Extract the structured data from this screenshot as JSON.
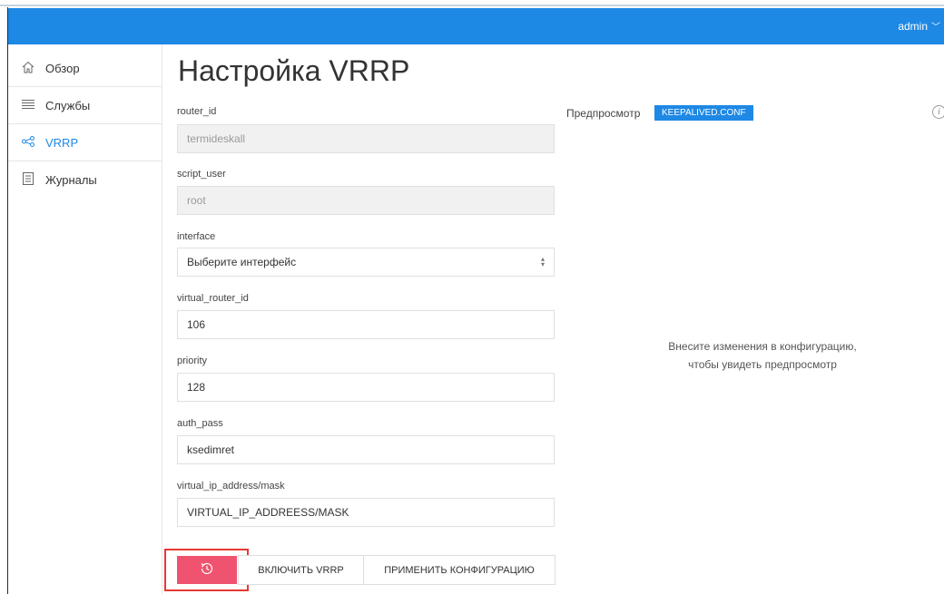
{
  "header": {
    "user": "admin",
    "user_chevron": "﹀"
  },
  "sidebar": {
    "items": [
      {
        "label": "Обзор",
        "icon": "home-icon"
      },
      {
        "label": "Службы",
        "icon": "list-icon"
      },
      {
        "label": "VRRP",
        "icon": "share-icon",
        "active": true
      },
      {
        "label": "Журналы",
        "icon": "document-icon"
      }
    ]
  },
  "main": {
    "title": "Настройка VRRP",
    "fields": {
      "router_id": {
        "label": "router_id",
        "value": "termideskall"
      },
      "script_user": {
        "label": "script_user",
        "value": "root"
      },
      "interface": {
        "label": "interface",
        "value": "Выберите интерфейс"
      },
      "virtual_router_id": {
        "label": "virtual_router_id",
        "value": "106"
      },
      "priority": {
        "label": "priority",
        "value": "128"
      },
      "auth_pass": {
        "label": "auth_pass",
        "value": "ksedimret"
      },
      "virtual_ip": {
        "label": "virtual_ip_address/mask",
        "value": "VIRTUAL_IP_ADDREESS/MASK"
      }
    },
    "buttons": {
      "enable": "ВКЛЮЧИТЬ VRRP",
      "apply": "ПРИМЕНИТЬ КОНФИГУРАЦИЮ"
    }
  },
  "preview": {
    "label": "Предпросмотр",
    "tag": "KEEPALIVED.CONF",
    "message_line1": "Внесите изменения в конфигурацию,",
    "message_line2": "чтобы увидеть предпросмотр"
  },
  "colors": {
    "accent": "#1e88e5",
    "history_button": "#ef5370",
    "highlight": "#e53935"
  }
}
